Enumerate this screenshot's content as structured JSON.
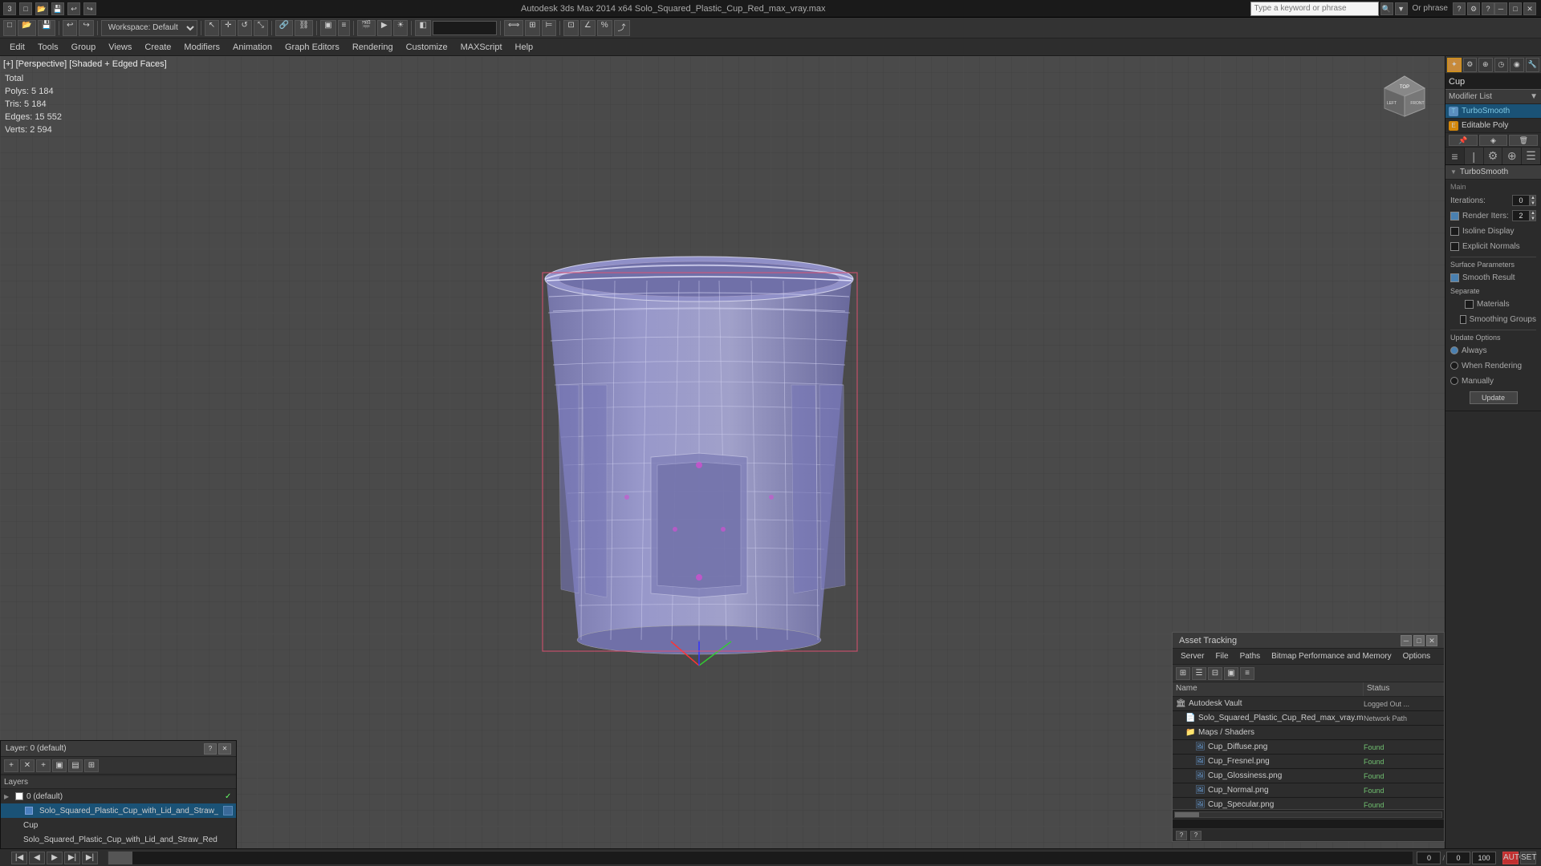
{
  "app": {
    "title": "Autodesk 3ds Max 2014 x64",
    "file": "Solo_Squared_Plastic_Cup_Red_max_vray.max",
    "window_title": "Autodesk 3ds Max 2014 x64      Solo_Squared_Plastic_Cup_Red_max_vray.max"
  },
  "titlebar": {
    "minimize": "─",
    "maximize": "□",
    "close": "✕",
    "search_placeholder": "Type a keyword or phrase",
    "or_phrase_label": "Or phrase"
  },
  "toolbar": {
    "workspace_label": "Workspace: Default",
    "buttons": [
      "New",
      "Open",
      "Save"
    ]
  },
  "menubar": {
    "items": [
      "Edit",
      "Tools",
      "Group",
      "Views",
      "Create",
      "Modifiers",
      "Animation",
      "Graph Editors",
      "Rendering",
      "Customize",
      "MAXScript",
      "Help"
    ]
  },
  "viewport": {
    "label": "[+] [Perspective] [Shaded + Edged Faces]",
    "stats": {
      "polys_label": "Polys:",
      "polys_value": "5 184",
      "tris_label": "Tris:",
      "tris_value": "5 184",
      "edges_label": "Edges:",
      "edges_value": "15 552",
      "verts_label": "Verts:",
      "verts_value": "2 594",
      "total_label": "Total"
    }
  },
  "modifier_panel": {
    "object_name": "Cup",
    "modifier_list_label": "Modifier List",
    "stack_items": [
      {
        "name": "TurboSmooth",
        "icon_type": "light-blue",
        "selected": true
      },
      {
        "name": "Editable Poly",
        "icon_type": "orange",
        "selected": false
      }
    ],
    "tab_icons": [
      "▣",
      "⊞",
      "⚙",
      "◎",
      "☰"
    ],
    "turbosmooth": {
      "title": "TurboSmooth",
      "main_label": "Main",
      "iterations_label": "Iterations:",
      "iterations_value": "0",
      "render_iters_label": "Render Iters:",
      "render_iters_value": "2",
      "isoline_display_label": "Isoline Display",
      "explicit_normals_label": "Explicit Normals",
      "surface_params_label": "Surface Parameters",
      "smooth_result_label": "Smooth Result",
      "smooth_result_checked": true,
      "separate_label": "Separate",
      "materials_label": "Materials",
      "smoothing_groups_label": "Smoothing Groups",
      "update_options_label": "Update Options",
      "always_label": "Always",
      "when_rendering_label": "When Rendering",
      "manually_label": "Manually",
      "update_btn": "Update"
    }
  },
  "layers_panel": {
    "title": "Layer: 0 (default)",
    "help_btn": "?",
    "close_btn": "✕",
    "toolbar_icons": [
      "+",
      "✕",
      "+",
      "▣",
      "▤",
      "⊞"
    ],
    "header": "Layers",
    "layers": [
      {
        "indent": 0,
        "name": "0 (default)",
        "checked": true,
        "selected": false,
        "expand": "▶"
      },
      {
        "indent": 1,
        "name": "Solo_Squared_Plastic_Cup_with_Lid_and_Straw_Red",
        "checked": false,
        "selected": true,
        "expand": ""
      },
      {
        "indent": 2,
        "name": "Cup",
        "checked": false,
        "selected": false,
        "expand": ""
      },
      {
        "indent": 2,
        "name": "Solo_Squared_Plastic_Cup_with_Lid_and_Straw_Red",
        "checked": false,
        "selected": false,
        "expand": ""
      }
    ]
  },
  "asset_tracking": {
    "title": "Asset Tracking",
    "minimize_btn": "─",
    "maximize_btn": "□",
    "close_btn": "✕",
    "menu_items": [
      "Server",
      "File",
      "Paths",
      "Bitmap Performance and Memory",
      "Options"
    ],
    "toolbar_icons": [
      "⊞",
      "☰",
      "⊟",
      "▣",
      "≡"
    ],
    "col_name": "Name",
    "col_status": "Status",
    "rows": [
      {
        "indent": 0,
        "icon": "🏛",
        "name": "Autodesk Vault",
        "status": "Logged Out ...",
        "type": "vault"
      },
      {
        "indent": 1,
        "icon": "📄",
        "name": "Solo_Squared_Plastic_Cup_Red_max_vray.max",
        "status": "Network Path",
        "type": "file"
      },
      {
        "indent": 1,
        "icon": "📁",
        "name": "Maps / Shaders",
        "status": "",
        "type": "folder"
      },
      {
        "indent": 2,
        "icon": "🖼",
        "name": "Cup_Diffuse.png",
        "status": "Found",
        "type": "image"
      },
      {
        "indent": 2,
        "icon": "🖼",
        "name": "Cup_Fresnel.png",
        "status": "Found",
        "type": "image"
      },
      {
        "indent": 2,
        "icon": "🖼",
        "name": "Cup_Glossiness.png",
        "status": "Found",
        "type": "image"
      },
      {
        "indent": 2,
        "icon": "🖼",
        "name": "Cup_Normal.png",
        "status": "Found",
        "type": "image"
      },
      {
        "indent": 2,
        "icon": "🖼",
        "name": "Cup_Specular.png",
        "status": "Found",
        "type": "image"
      }
    ],
    "help_icons": [
      "?",
      "?"
    ]
  },
  "bottom_bar": {
    "frame_current": "0",
    "frame_start": "0",
    "frame_end": "100",
    "time_display": "0"
  },
  "icons": {
    "search": "🔍",
    "help": "?",
    "lock": "🔒",
    "folder": "📁",
    "file": "📄",
    "image": "🖼",
    "vault": "🏛"
  }
}
